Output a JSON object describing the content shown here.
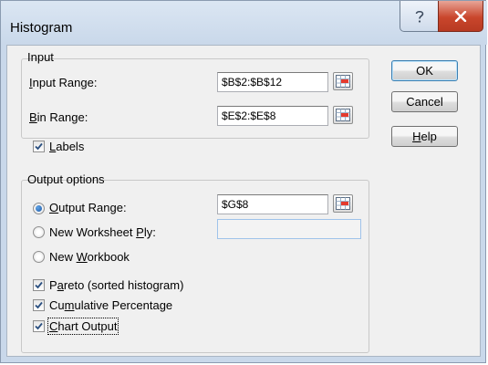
{
  "dialog": {
    "title": "Histogram",
    "help_glyph": "?",
    "close_glyph": "X"
  },
  "input_group": {
    "title": "Input",
    "input_range": {
      "label_key": "I",
      "label_rest": "nput Range:",
      "value": "$B$2:$B$12"
    },
    "bin_range": {
      "label_key": "B",
      "label_rest": "in Range:",
      "value": "$E$2:$E$8"
    }
  },
  "labels_checkbox": {
    "label_key": "L",
    "label_rest": "abels",
    "checked": true
  },
  "output_group": {
    "title": "Output options",
    "output_range": {
      "label_key": "O",
      "label_rest": "utput Range:",
      "value": "$G$8",
      "selected": true
    },
    "new_worksheet": {
      "label_pre": "New Worksheet ",
      "label_key": "P",
      "label_rest": "ly:",
      "value": "",
      "selected": false
    },
    "new_workbook": {
      "label_pre": "New ",
      "label_key": "W",
      "label_rest": "orkbook",
      "selected": false
    },
    "pareto": {
      "label_pre": "P",
      "label_key": "a",
      "label_rest": "reto (sorted histogram)",
      "checked": true
    },
    "cumulative": {
      "label_pre": "Cu",
      "label_key": "m",
      "label_rest": "ulative Percentage",
      "checked": true
    },
    "chart_output": {
      "label_key": "C",
      "label_rest": "hart Output",
      "checked": true
    }
  },
  "buttons": {
    "ok": "OK",
    "cancel": "Cancel",
    "help_key": "H",
    "help_rest": "elp"
  },
  "icons": {
    "refedit": "range-select-icon",
    "check": "checkmark-icon",
    "help": "question-mark-icon",
    "close": "close-icon"
  }
}
